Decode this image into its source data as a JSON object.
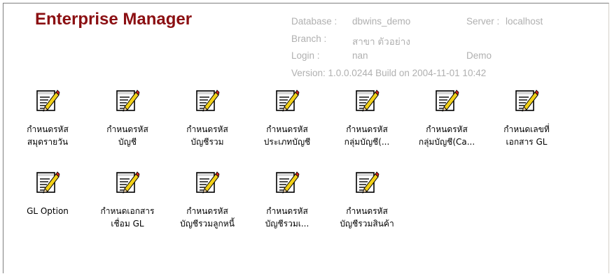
{
  "title": "Enterprise Manager",
  "info": {
    "database_label": "Database :",
    "database_value": "dbwins_demo",
    "server_label": "Server :",
    "server_value": "localhost",
    "branch_label": "Branch :",
    "branch_value": "สาขา ตัวอย่าง",
    "login_label": "Login :",
    "login_value": "nan",
    "login_extra": "Demo",
    "version": "Version: 1.0.0.0244  Build on 2004-11-01 10:42"
  },
  "icon_name": "edit-document-pencil-icon",
  "items": [
    {
      "line1": "กำหนดรหัส",
      "line2": "สมุดรายวัน"
    },
    {
      "line1": "กำหนดรหัส",
      "line2": "บัญชี"
    },
    {
      "line1": "กำหนดรหัส",
      "line2": "บัญชีรวม"
    },
    {
      "line1": "กำหนดรหัส",
      "line2": "ประเภทบัญชี"
    },
    {
      "line1": "กำหนดรหัส",
      "line2": "กลุ่มบัญชี(..."
    },
    {
      "line1": "กำหนดรหัส",
      "line2": "กลุ่มบัญชี(Ca..."
    },
    {
      "line1": "กำหนดเลขที่",
      "line2": "เอกสาร GL"
    },
    {
      "line1": "GL Option",
      "line2": ""
    },
    {
      "line1": "กำหนดเอกสาร",
      "line2": "เชื่อม GL"
    },
    {
      "line1": "กำหนดรหัส",
      "line2": "บัญชีรวมลูกหนี้"
    },
    {
      "line1": "กำหนดรหัส",
      "line2": "บัญชีรวมเ..."
    },
    {
      "line1": "กำหนดรหัส",
      "line2": "บัญชีรวมสินค้า"
    }
  ]
}
